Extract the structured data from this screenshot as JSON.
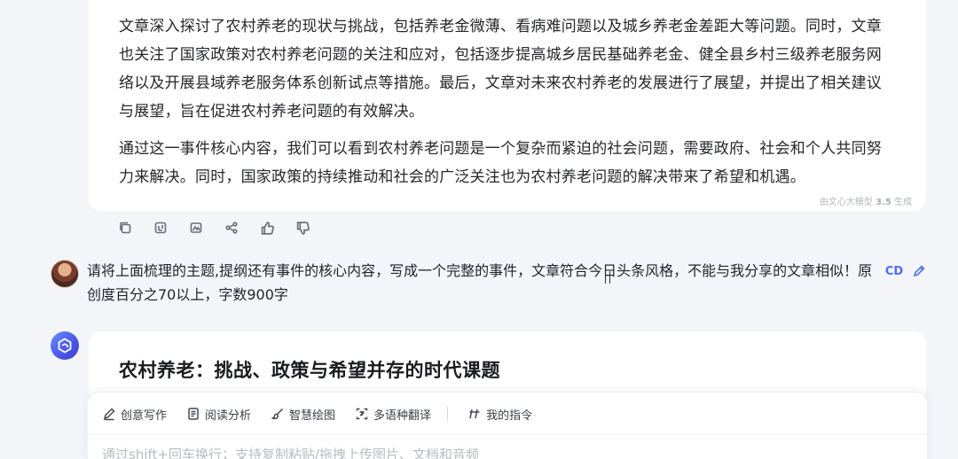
{
  "answer": {
    "paragraphs": [
      "文章深入探讨了农村养老的现状与挑战，包括养老金微薄、看病难问题以及城乡养老金差距大等问题。同时，文章也关注了国家政策对农村养老问题的关注和应对，包括逐步提高城乡居民基础养老金、健全县乡村三级养老服务网络以及开展县域养老服务体系创新试点等措施。最后，文章对未来农村养老的发展进行了展望，并提出了相关建议与展望，旨在促进农村养老问题的有效解决。",
      "通过这一事件核心内容，我们可以看到农村养老问题是一个复杂而紧迫的社会问题，需要政府、社会和个人共同努力来解决。同时，国家政策的持续推动和社会的广泛关注也为农村养老问题的解决带来了希望和机遇。"
    ],
    "model_tag_prefix": "由文心大模型",
    "model_tag_version": "3.5",
    "model_tag_suffix": "生成"
  },
  "actions": [
    {
      "name": "copy-icon"
    },
    {
      "name": "export-icon"
    },
    {
      "name": "image-icon"
    },
    {
      "name": "share-icon"
    },
    {
      "name": "thumbs-up-icon"
    },
    {
      "name": "thumbs-down-icon"
    }
  ],
  "user": {
    "message": "请将上面梳理的主题,提纲还有事件的核心内容，写成一个完整的事件，文章符合今日头条风格，不能与我分享的文章相似！原创度百分之70以上，字数900字",
    "copy_label": "CD",
    "edit_icon": "pencil-icon"
  },
  "answer2": {
    "title": "农村养老：挑战、政策与希望并存的时代课题"
  },
  "composer": {
    "tools": [
      {
        "label": "创意写作",
        "icon": "pen-icon"
      },
      {
        "label": "阅读分析",
        "icon": "document-icon"
      },
      {
        "label": "智慧绘图",
        "icon": "brush-icon"
      },
      {
        "label": "多语种翻译",
        "icon": "translate-icon"
      },
      {
        "label": "我的指令",
        "icon": "command-icon"
      }
    ],
    "placeholder": "通过shift+回车换行；支持复制粘贴/拖拽上传图片、文档和音频"
  }
}
